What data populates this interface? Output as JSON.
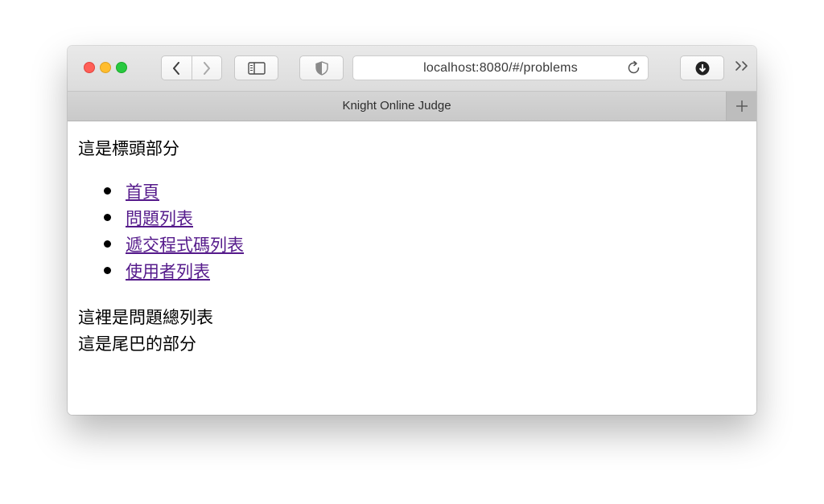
{
  "browser": {
    "url": "localhost:8080/#/problems",
    "tab_title": "Knight Online Judge"
  },
  "page": {
    "header_text": "這是標頭部分",
    "nav_links": [
      {
        "label": "首頁"
      },
      {
        "label": "問題列表"
      },
      {
        "label": "遞交程式碼列表"
      },
      {
        "label": "使用者列表"
      }
    ],
    "body_text": "這裡是問題總列表",
    "footer_text": "這是尾巴的部分"
  },
  "colors": {
    "link": "#551a8b",
    "close": "#ff5f57",
    "minimize": "#ffbd2e",
    "maximize": "#28c940"
  },
  "icons": [
    "back-icon",
    "forward-icon",
    "sidebar-icon",
    "privacy-shield-icon",
    "reload-icon",
    "download-icon",
    "more-icon",
    "new-tab-icon"
  ]
}
